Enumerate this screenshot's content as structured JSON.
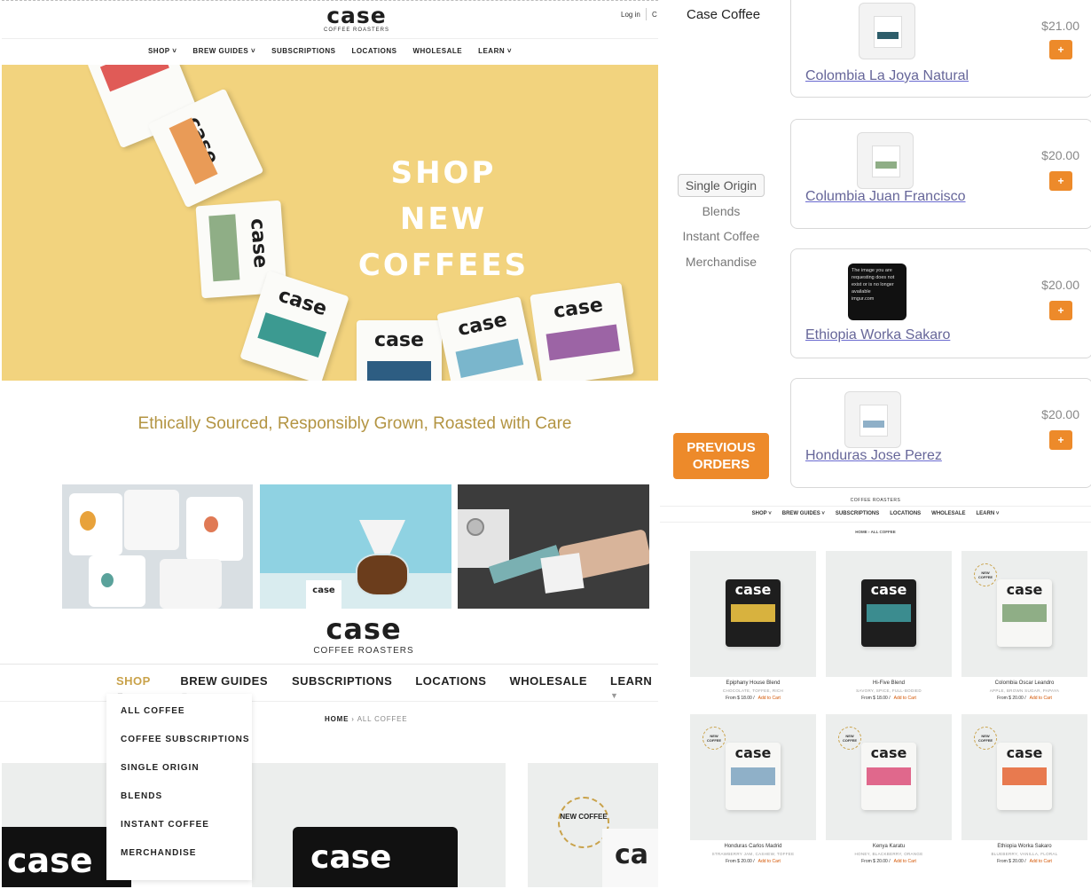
{
  "home": {
    "logo": "case",
    "logo_sub": "COFFEE ROASTERS",
    "login": "Log in",
    "cart_partial": "C",
    "nav": [
      "SHOP",
      "BREW GUIDES",
      "SUBSCRIPTIONS",
      "LOCATIONS",
      "WHOLESALE",
      "LEARN"
    ],
    "hero_line1": "SHOP NEW",
    "hero_line2": "COFFEES",
    "tagline": "Ethically Sourced, Responsibly Grown, Roasted with Care",
    "bag_word": "case"
  },
  "shop": {
    "logo": "case",
    "logo_sub": "COFFEE ROASTERS",
    "nav": [
      "SHOP",
      "BREW GUIDES",
      "SUBSCRIPTIONS",
      "LOCATIONS",
      "WHOLESALE",
      "LEARN"
    ],
    "breadcrumb_home": "HOME",
    "breadcrumb_sep": "›",
    "breadcrumb_current": "ALL COFFEE",
    "dropdown": [
      "ALL COFFEE",
      "COFFEE SUBSCRIPTIONS",
      "SINGLE ORIGIN",
      "BLENDS",
      "INSTANT COFFEE",
      "MERCHANDISE"
    ],
    "badge": "NEW COFFEE",
    "bag_word": "case",
    "bag_partial": "ca"
  },
  "app": {
    "title": "Case Coffee",
    "categories": [
      "Single Origin",
      "Blends",
      "Instant Coffee",
      "Merchandise"
    ],
    "selected_category": "Single Origin",
    "previous_orders": "PREVIOUS ORDERS",
    "products": [
      {
        "name": "Colombia La Joya Natural",
        "price": "$21.00"
      },
      {
        "name": "Columbia Juan Francisco",
        "price": "$20.00"
      },
      {
        "name": "Ethiopia Worka Sakaro",
        "price": "$20.00"
      },
      {
        "name": "Honduras Jose Perez",
        "price": "$20.00"
      }
    ],
    "plus": "+",
    "broken_image_text": "The image you are requesting does not exist or is no longer available",
    "broken_image_source": "imgur.com"
  },
  "grid": {
    "logo_sub": "COFFEE ROASTERS",
    "nav": [
      "SHOP",
      "BREW GUIDES",
      "SUBSCRIPTIONS",
      "LOCATIONS",
      "WHOLESALE",
      "LEARN"
    ],
    "breadcrumb": "HOME › ALL COFFEE",
    "add_to_cart": "Add to Cart",
    "items": [
      {
        "name": "Epiphany House Blend",
        "notes": "CHOCOLATE, TOFFEE, RICH",
        "price": "From $ 18.00 /",
        "badge": "",
        "bag": "#1e1e1e",
        "label": "#d8b23e"
      },
      {
        "name": "Hi-Five Blend",
        "notes": "SAVORY, SPICE, FULL-BODIED",
        "price": "From $ 18.00 /",
        "badge": "",
        "bag": "#1e1e1e",
        "label": "#3b8c8f"
      },
      {
        "name": "Colombia Oscar Leandro",
        "notes": "APPLE, BROWN SUGAR, PAPAYA",
        "price": "From $ 20.00 /",
        "badge": "NEW COFFEE",
        "bag": "#f7f7f5",
        "label": "#8fae86"
      },
      {
        "name": "Honduras Carlos Madrid",
        "notes": "STRAWBERRY JAM, CASHEW, TOFFEE",
        "price": "From $ 20.00 /",
        "badge": "NEW COFFEE",
        "bag": "#f7f7f5",
        "label": "#8fb0c8"
      },
      {
        "name": "Kenya Karatu",
        "notes": "HONEY, BLACKBERRY, ORANGE",
        "price": "From $ 20.00 /",
        "badge": "NEW COFFEE",
        "bag": "#f7f7f5",
        "label": "#e0688c"
      },
      {
        "name": "Ethiopia Worka Sakaro",
        "notes": "BLUEBERRY, VANILLA, FLORAL",
        "price": "From $ 20.00 /",
        "badge": "NEW COFFEE",
        "bag": "#f7f7f5",
        "label": "#e87a4f"
      }
    ]
  },
  "colors": {
    "accent_orange": "#ed8a2a",
    "tagline_gold": "#b39442",
    "hero_yellow": "#f2d37e"
  }
}
